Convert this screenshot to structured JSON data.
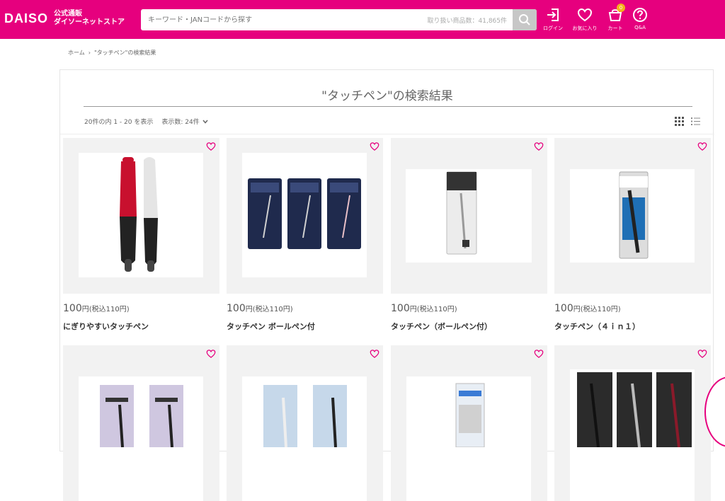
{
  "header": {
    "logo": "DAISO",
    "subtitle_line1": "公式通販",
    "subtitle_line2": "ダイソーネットストア",
    "search_placeholder": "キーワード・JANコードから探す",
    "search_count": "取り扱い商品数：41,865件",
    "login_label": "ログイン",
    "favorites_label": "お気に入り",
    "cart_label": "カート",
    "cart_count": "0",
    "qa_label": "Q&A"
  },
  "breadcrumb": {
    "home": "ホーム",
    "separator": "›",
    "current": "\"タッチペン\"の検索結果"
  },
  "results": {
    "title": "\"タッチペン\"の検索結果",
    "range": "20件の内 1 - 20 を表示",
    "per_page": "表示数: 24件"
  },
  "products": [
    {
      "price": "100",
      "tax": "円(税込110円)",
      "name": "にぎりやすいタッチペン"
    },
    {
      "price": "100",
      "tax": "円(税込110円)",
      "name": "タッチペン ボールペン付"
    },
    {
      "price": "100",
      "tax": "円(税込110円)",
      "name": "タッチペン（ボールペン付）"
    },
    {
      "price": "100",
      "tax": "円(税込110円)",
      "name": "タッチペン（４ｉｎ１）"
    },
    {
      "price": "",
      "tax": "",
      "name": ""
    },
    {
      "price": "",
      "tax": "",
      "name": ""
    },
    {
      "price": "",
      "tax": "",
      "name": ""
    },
    {
      "price": "",
      "tax": "",
      "name": ""
    }
  ],
  "colors": {
    "brand": "#e6007e",
    "badge": "#f5b11b"
  }
}
